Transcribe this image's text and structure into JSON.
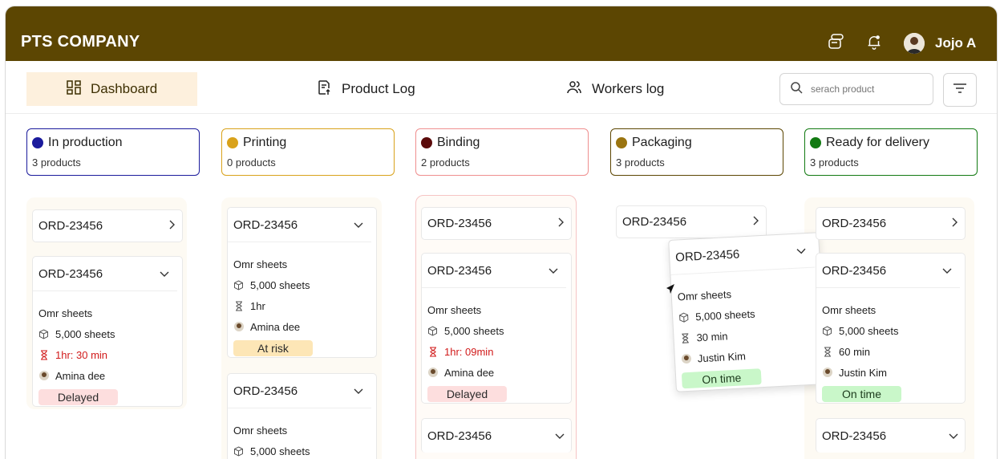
{
  "header": {
    "brand": "PTS COMPANY",
    "user_name": "Jojo A"
  },
  "nav": {
    "dashboard": "Dashboard",
    "product_log": "Product Log",
    "workers_log": "Workers log"
  },
  "search": {
    "placeholder": "serach product"
  },
  "columns": [
    {
      "title": "In production",
      "count": "3 products",
      "color": "#1b1b9c"
    },
    {
      "title": "Printing",
      "count": "0 products",
      "color": "#d9a21b"
    },
    {
      "title": "Binding",
      "count": "2 products",
      "color": "#5b0b0b"
    },
    {
      "title": "Packaging",
      "count": "3 products",
      "color": "#9a7410"
    },
    {
      "title": "Ready for delivery",
      "count": "3 products",
      "color": "#127a12"
    }
  ],
  "cards": {
    "c1a": {
      "id": "ORD-23456"
    },
    "c1b": {
      "id": "ORD-23456",
      "material": "Omr sheets",
      "qty": "5,000 sheets",
      "time": "1hr: 30 min",
      "worker": "Amina dee",
      "status": "Delayed"
    },
    "c2a": {
      "id": "ORD-23456",
      "material": "Omr sheets",
      "qty": "5,000 sheets",
      "time": "1hr",
      "worker": "Amina dee",
      "status": "At risk"
    },
    "c2b": {
      "id": "ORD-23456",
      "material": "Omr sheets",
      "qty": "5,000 sheets"
    },
    "c3a": {
      "id": "ORD-23456"
    },
    "c3b": {
      "id": "ORD-23456",
      "material": "Omr sheets",
      "qty": "5,000 sheets",
      "time": "1hr: 09min",
      "worker": "Amina dee",
      "status": "Delayed"
    },
    "c3c": {
      "id": "ORD-23456"
    },
    "c4a": {
      "id": "ORD-23456"
    },
    "c4b": {
      "id": "ORD-23456",
      "material": "Omr sheets",
      "qty": "5,000 sheets",
      "time": "30 min",
      "worker": "Justin Kim",
      "status": "On time"
    },
    "c5a": {
      "id": "ORD-23456"
    },
    "c5b": {
      "id": "ORD-23456",
      "material": "Omr sheets",
      "qty": "5,000 sheets",
      "time": "60 min",
      "worker": "Justin Kim",
      "status": "On time"
    },
    "c5c": {
      "id": "ORD-23456"
    }
  },
  "status_colors": {
    "delayed": "#fddede",
    "at_risk": "#fde6b6",
    "on_time": "#c9f7c9"
  }
}
